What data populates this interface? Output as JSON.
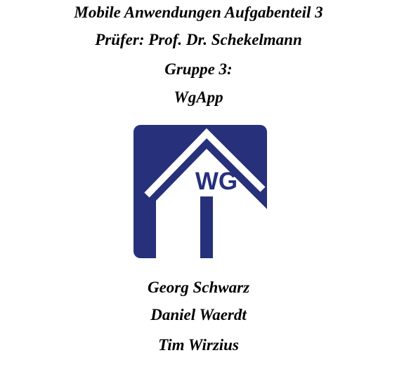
{
  "header": {
    "course": "Mobile Anwendungen Aufgabenteil 3",
    "examiner": "Prüfer: Prof. Dr. Schekelmann",
    "group": "Gruppe 3:",
    "app_name": "WgApp"
  },
  "logo": {
    "text": "WG",
    "color": "#27307a",
    "background": "#ffffff"
  },
  "authors": [
    "Georg Schwarz",
    "Daniel Waerdt",
    "Tim Wirzius"
  ]
}
